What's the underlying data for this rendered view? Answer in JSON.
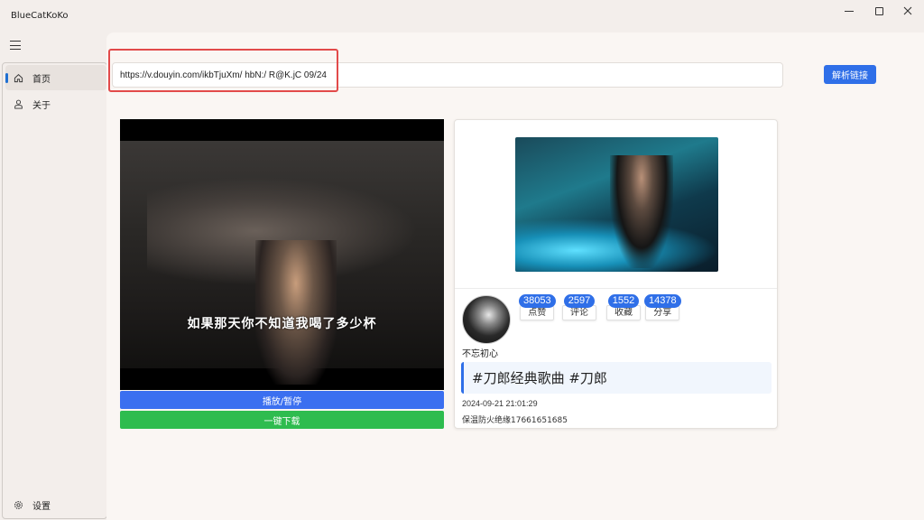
{
  "window": {
    "title": "BlueCatKoKo"
  },
  "sidebar": {
    "items": [
      {
        "label": "首页",
        "icon": "home-icon",
        "active": true
      },
      {
        "label": "关于",
        "icon": "person-icon",
        "active": false
      }
    ],
    "footer_item": {
      "label": "设置",
      "icon": "gear-icon"
    }
  },
  "search": {
    "value": "https://v.douyin.com/ikbTjuXm/ hbN:/ R@K.jC 09/24",
    "parse_label": "解析链接"
  },
  "player": {
    "subtitle": "如果那天你不知道我喝了多少杯",
    "play_label": "播放/暂停",
    "download_label": "一键下载"
  },
  "video_info": {
    "author": "不忘初心",
    "stats": [
      {
        "value": "38053",
        "label": "点赞"
      },
      {
        "value": "2597",
        "label": "评论"
      },
      {
        "value": "1552",
        "label": "收藏"
      },
      {
        "value": "14378",
        "label": "分享"
      }
    ],
    "description": "#刀郎经典歌曲 #刀郎",
    "publish_time": "2024-09-21 21:01:29",
    "signature": "保温防火绝缘17661651685"
  },
  "colors": {
    "accent": "#2f6fe8",
    "download": "#2ebc4f",
    "highlight": "#e24a4a"
  }
}
